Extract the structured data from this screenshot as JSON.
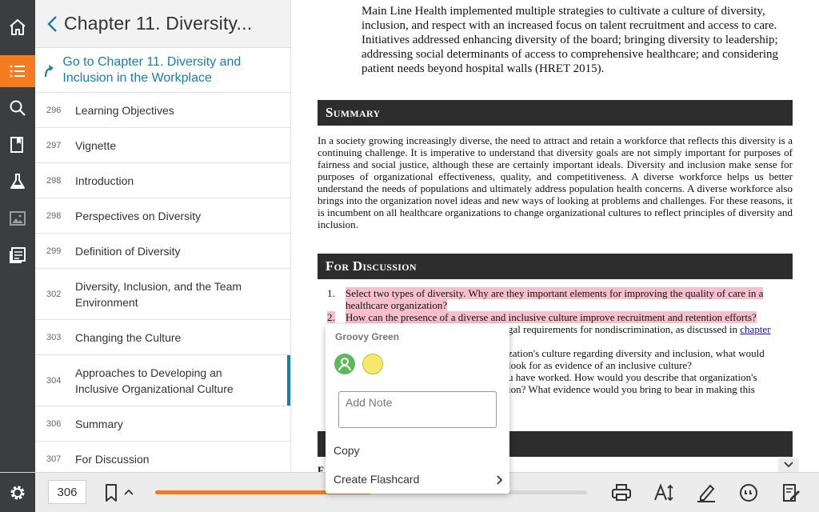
{
  "toc": {
    "header_title": "Chapter 11. Diversity...",
    "goto_label": "Go to Chapter 11. Diversity and Inclusion in the Workplace",
    "items": [
      {
        "page": "296",
        "label": "Learning Objectives"
      },
      {
        "page": "297",
        "label": "Vignette"
      },
      {
        "page": "298",
        "label": "Introduction"
      },
      {
        "page": "298",
        "label": "Perspectives on Diversity"
      },
      {
        "page": "299",
        "label": "Definition of Diversity"
      },
      {
        "page": "302",
        "label": "Diversity, Inclusion, and the Team Environment"
      },
      {
        "page": "303",
        "label": "Changing the Culture"
      },
      {
        "page": "304",
        "label": "Approaches to Developing an Inclusive Organizational Culture"
      },
      {
        "page": "306",
        "label": "Summary"
      },
      {
        "page": "307",
        "label": "For Discussion"
      }
    ]
  },
  "content": {
    "top_paragraph": "Main Line Health implemented multiple strategies to cultivate a culture of diversity, inclusion, and respect with an increased focus on talent recruitment and access to care. Initiatives addressed enhancing diversity of the board; bringing diversity to leadership; addressing social determinants of access to comprehensive healthcare; and considering patient needs beyond hospital walls (HRET 2015).",
    "summary_heading": "Summary",
    "summary_text": "In a society growing increasingly diverse, the need to attract and retain a workforce that reflects this diversity is a continuing challenge. It is imperative to understand that diversity goals are not simply important for purposes of fairness and social justice, although these are certainly important ideals. Diversity and inclusion make sense for purposes of organizational effectiveness, quality, and competitiveness. A diverse workforce helps us better understand the needs of populations and ultimately address population health concerns. A diverse workforce also brings into the organization novel ideas and new ways of looking at problems and challenges. For these reasons, it is incumbent on all healthcare organizations to change organizational cultures to reflect principles of diversity and inclusion.",
    "discussion_heading": "For Discussion",
    "q1_num": "1.",
    "q1_text": "Select two types of diversity. Why are they important elements for improving the quality of care in a healthcare organization?",
    "q2_num": "2.",
    "q2_text": "How can the presence of a diverse and inclusive culture improve recruitment and retention efforts?",
    "q3_fragment": "gal requirements for nondiscrimination, as discussed in",
    "q3_link": "chapter",
    "q4_line1": "zation's culture regarding diversity and inclusion, what would",
    "q4_line2": "look for as evidence of an inclusive culture?",
    "q5_line1": "u have worked. How would you describe that organization's",
    "q5_line2": "ion? What evidence would you bring to bear in making this",
    "bottom_fragment": "F"
  },
  "popup": {
    "title": "Groovy Green",
    "note_placeholder": "Add Note",
    "copy_label": "Copy",
    "flashcard_label": "Create Flashcard",
    "colors": {
      "green": "#5cb85c",
      "yellow": "#f5e86a"
    }
  },
  "bottom": {
    "page_number": "306",
    "progress_fraction": 0.5
  },
  "colors": {
    "accent": "#f47b20",
    "link": "#1a7fa4",
    "highlight": "#f6bfd0"
  }
}
